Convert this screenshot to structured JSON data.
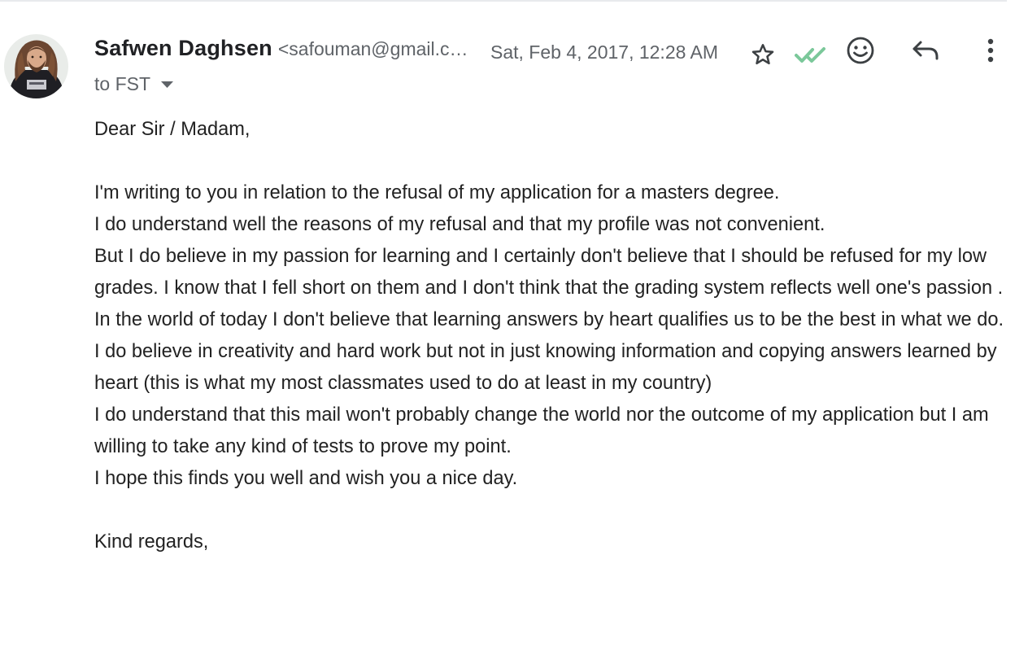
{
  "message": {
    "sender_name": "Safwen Daghsen",
    "sender_email": "<safouman@gmail.com>",
    "date": "Sat, Feb 4, 2017, 12:28 AM",
    "recipient": "to FST"
  },
  "actions": {
    "star_icon": "star-icon",
    "read_icon": "double-check-icon",
    "emoji_icon": "emoji-icon",
    "reply_icon": "reply-icon",
    "more_icon": "more-vert-icon",
    "read_color": "#7bc89a"
  },
  "body": {
    "greeting": "Dear Sir / Madam,",
    "lines": [
      "I'm writing to you in relation to the refusal of my application for a masters degree.",
      "I do understand well the reasons of my refusal and that my profile was not convenient.",
      "But I do believe in my passion for learning and I certainly don't believe that I should be refused for my low grades. I know that I fell short on them and I don't think that the grading system reflects well one's passion . In the world of today I don't believe that learning answers by heart qualifies us to be the best in what we do. I do believe in creativity and hard work but not in just knowing information and copying answers learned by heart (this is what my most classmates used to do at least in my country)",
      "I do understand that this mail won't probably change the world nor the outcome of my application but I am willing to take any kind of tests to prove my point.",
      "I hope this finds you well and wish you a nice day."
    ],
    "closing": "Kind regards,"
  }
}
